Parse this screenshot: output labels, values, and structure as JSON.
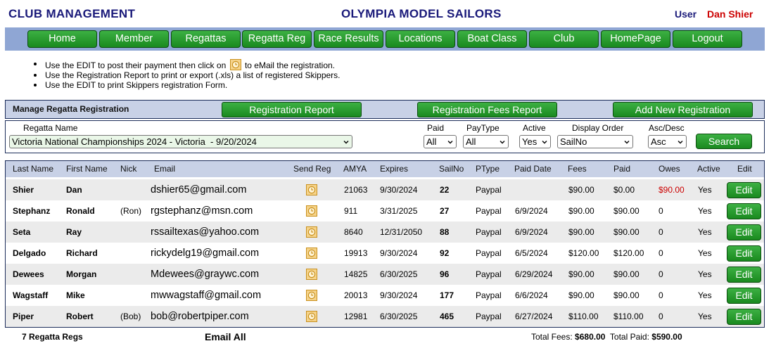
{
  "header": {
    "club_title": "CLUB MANAGEMENT",
    "org_title": "OLYMPIA MODEL SAILORS",
    "user_label": "User",
    "user_name": "Dan Shier"
  },
  "nav": [
    {
      "label": "Home"
    },
    {
      "label": "Member"
    },
    {
      "label": "Regattas"
    },
    {
      "label": "Regatta Reg"
    },
    {
      "label": "Race Results"
    },
    {
      "label": "Locations"
    },
    {
      "label": "Boat Class"
    },
    {
      "label": "Club"
    },
    {
      "label": "HomePage"
    },
    {
      "label": "Logout"
    }
  ],
  "tips": {
    "tip1_before": "Use the EDIT to post their payment then click on",
    "tip1_after": "to eMail the registration.",
    "tip2": "Use the Registration Report to print or export (.xls) a list of registered Skippers.",
    "tip3": "Use the EDIT to print Skippers registration Form."
  },
  "manage": {
    "title": "Manage Regatta Registration",
    "report_btn": "Registration Report",
    "fees_report_btn": "Registration Fees Report",
    "add_btn": "Add New Registration"
  },
  "filters": {
    "regatta_label": "Regatta Name",
    "regatta_value": "Victoria National Championships 2024 - Victoria  - 9/20/2024",
    "paid_label": "Paid",
    "paid_value": "All",
    "paytype_label": "PayType",
    "paytype_value": "All",
    "active_label": "Active",
    "active_value": "Yes",
    "order_label": "Display Order",
    "order_value": "SailNo",
    "ascdesc_label": "Asc/Desc",
    "ascdesc_value": "Asc",
    "search_btn": "Search"
  },
  "table": {
    "headers": {
      "last": "Last Name",
      "first": "First Name",
      "nick": "Nick",
      "email": "Email",
      "send": "Send Reg",
      "amya": "AMYA",
      "expires": "Expires",
      "sailno": "SailNo",
      "ptype": "PType",
      "paiddate": "Paid Date",
      "fees": "Fees",
      "paid": "Paid",
      "owes": "Owes",
      "active": "Active",
      "edit": "Edit"
    },
    "edit_label": "Edit",
    "rows": [
      {
        "last": "Shier",
        "first": "Dan",
        "nick": "",
        "email": "dshier65@gmail.com",
        "amya": "21063",
        "expires": "9/30/2024",
        "sailno": "22",
        "ptype": "Paypal",
        "paiddate": "",
        "fees": "$90.00",
        "paid": "$0.00",
        "owes": "$90.00",
        "active": "Yes"
      },
      {
        "last": "Stephanz",
        "first": "Ronald",
        "nick": "(Ron)",
        "email": "rgstephanz@msn.com",
        "amya": "911",
        "expires": "3/31/2025",
        "sailno": "27",
        "ptype": "Paypal",
        "paiddate": "6/9/2024",
        "fees": "$90.00",
        "paid": "$90.00",
        "owes": "0",
        "active": "Yes"
      },
      {
        "last": "Seta",
        "first": "Ray",
        "nick": "",
        "email": "rssailtexas@yahoo.com",
        "amya": "8640",
        "expires": "12/31/2050",
        "sailno": "88",
        "ptype": "Paypal",
        "paiddate": "6/9/2024",
        "fees": "$90.00",
        "paid": "$90.00",
        "owes": "0",
        "active": "Yes"
      },
      {
        "last": "Delgado",
        "first": "Richard",
        "nick": "",
        "email": "rickydelg19@gmail.com",
        "amya": "19913",
        "expires": "9/30/2024",
        "sailno": "92",
        "ptype": "Paypal",
        "paiddate": "6/5/2024",
        "fees": "$120.00",
        "paid": "$120.00",
        "owes": "0",
        "active": "Yes"
      },
      {
        "last": "Dewees",
        "first": "Morgan",
        "nick": "",
        "email": "Mdewees@graywc.com",
        "amya": "14825",
        "expires": "6/30/2025",
        "sailno": "96",
        "ptype": "Paypal",
        "paiddate": "6/29/2024",
        "fees": "$90.00",
        "paid": "$90.00",
        "owes": "0",
        "active": "Yes"
      },
      {
        "last": "Wagstaff",
        "first": "Mike",
        "nick": "",
        "email": "mwwagstaff@gmail.com",
        "amya": "20013",
        "expires": "9/30/2024",
        "sailno": "177",
        "ptype": "Paypal",
        "paiddate": "6/6/2024",
        "fees": "$90.00",
        "paid": "$90.00",
        "owes": "0",
        "active": "Yes"
      },
      {
        "last": "Piper",
        "first": "Robert",
        "nick": "(Bob)",
        "email": "bob@robertpiper.com",
        "amya": "12981",
        "expires": "6/30/2025",
        "sailno": "465",
        "ptype": "Paypal",
        "paiddate": "6/27/2024",
        "fees": "$110.00",
        "paid": "$110.00",
        "owes": "0",
        "active": "Yes"
      }
    ]
  },
  "footer": {
    "count": "7 Regatta Regs",
    "email_all": "Email All",
    "total_fees_label": "Total Fees:",
    "total_fees": "$680.00",
    "total_paid_label": "Total Paid:",
    "total_paid": "$590.00"
  }
}
